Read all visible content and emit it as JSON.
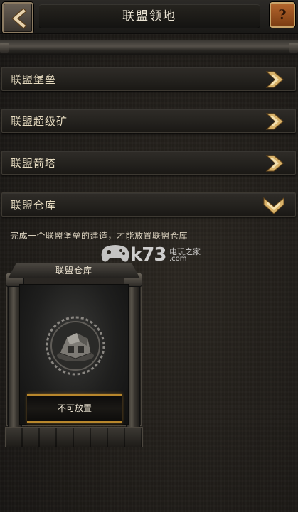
{
  "header": {
    "title": "联盟领地",
    "help_label": "?"
  },
  "categories": [
    {
      "label": "联盟堡垒",
      "state": "collapsed"
    },
    {
      "label": "联盟超级矿",
      "state": "collapsed"
    },
    {
      "label": "联盟箭塔",
      "state": "collapsed"
    },
    {
      "label": "联盟仓库",
      "state": "expanded"
    }
  ],
  "hint_text": "完成一个联盟堡垒的建造，才能放置联盟仓库",
  "building_card": {
    "title": "联盟仓库",
    "status": "不可放置",
    "icon": "warehouse-icon"
  },
  "watermark": {
    "brand": "k73",
    "tagline": "电玩之家",
    "domain": ".com"
  },
  "colors": {
    "accent_gold": "#b8872c",
    "arrow_gold": "#d9b36a",
    "help_button": "#a85a25"
  }
}
